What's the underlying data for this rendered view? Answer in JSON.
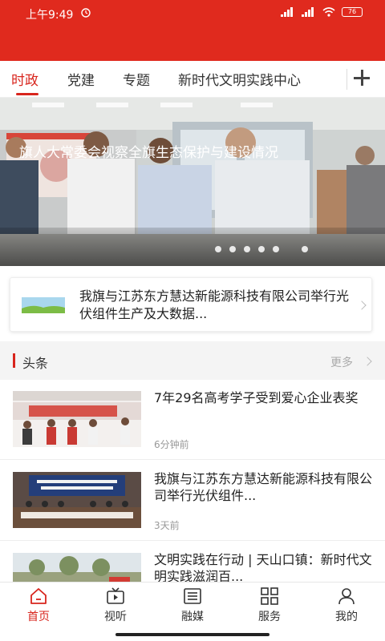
{
  "status_bar": {
    "time": "上午9:49",
    "battery": "76"
  },
  "tabs": [
    {
      "label": "时政"
    },
    {
      "label": "党建"
    },
    {
      "label": "专题"
    },
    {
      "label": "新时代文明实践中心"
    }
  ],
  "banner": {
    "title": "旗人大常委会视察全旗生态保护与建设情况",
    "total_slides": 6,
    "active_slide": 6
  },
  "notice": {
    "text": "我旗与江苏东方慧达新能源科技有限公司举行光伏组件生产及大数据..."
  },
  "headlines": {
    "title": "头条",
    "more": "更多",
    "items": [
      {
        "title": "7年29名高考学子受到爱心企业表奖",
        "time": "6分钟前"
      },
      {
        "title": "我旗与江苏东方慧达新能源科技有限公司举行光伏组件...",
        "time": "3天前"
      },
      {
        "title": "文明实践在行动 | 天山口镇：新时代文明实践滋润百...",
        "time": ""
      }
    ]
  },
  "bottom_nav": [
    {
      "label": "首页"
    },
    {
      "label": "视听"
    },
    {
      "label": "融媒"
    },
    {
      "label": "服务"
    },
    {
      "label": "我的"
    }
  ],
  "colors": {
    "brand_red": "#e02a1e",
    "active_text": "#d8251d"
  }
}
